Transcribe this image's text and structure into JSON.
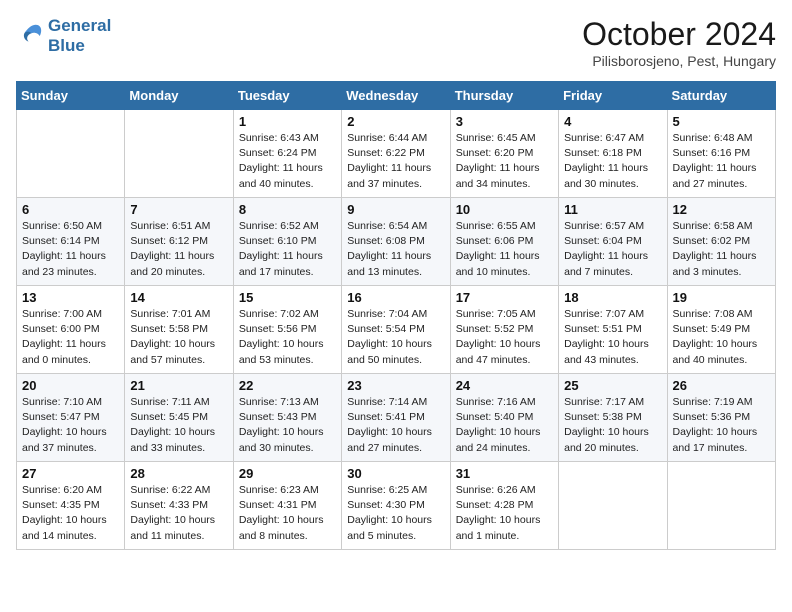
{
  "header": {
    "logo_line1": "General",
    "logo_line2": "Blue",
    "month": "October 2024",
    "location": "Pilisborosjeno, Pest, Hungary"
  },
  "weekdays": [
    "Sunday",
    "Monday",
    "Tuesday",
    "Wednesday",
    "Thursday",
    "Friday",
    "Saturday"
  ],
  "weeks": [
    [
      {
        "day": "",
        "info": ""
      },
      {
        "day": "",
        "info": ""
      },
      {
        "day": "1",
        "info": "Sunrise: 6:43 AM\nSunset: 6:24 PM\nDaylight: 11 hours and 40 minutes."
      },
      {
        "day": "2",
        "info": "Sunrise: 6:44 AM\nSunset: 6:22 PM\nDaylight: 11 hours and 37 minutes."
      },
      {
        "day": "3",
        "info": "Sunrise: 6:45 AM\nSunset: 6:20 PM\nDaylight: 11 hours and 34 minutes."
      },
      {
        "day": "4",
        "info": "Sunrise: 6:47 AM\nSunset: 6:18 PM\nDaylight: 11 hours and 30 minutes."
      },
      {
        "day": "5",
        "info": "Sunrise: 6:48 AM\nSunset: 6:16 PM\nDaylight: 11 hours and 27 minutes."
      }
    ],
    [
      {
        "day": "6",
        "info": "Sunrise: 6:50 AM\nSunset: 6:14 PM\nDaylight: 11 hours and 23 minutes."
      },
      {
        "day": "7",
        "info": "Sunrise: 6:51 AM\nSunset: 6:12 PM\nDaylight: 11 hours and 20 minutes."
      },
      {
        "day": "8",
        "info": "Sunrise: 6:52 AM\nSunset: 6:10 PM\nDaylight: 11 hours and 17 minutes."
      },
      {
        "day": "9",
        "info": "Sunrise: 6:54 AM\nSunset: 6:08 PM\nDaylight: 11 hours and 13 minutes."
      },
      {
        "day": "10",
        "info": "Sunrise: 6:55 AM\nSunset: 6:06 PM\nDaylight: 11 hours and 10 minutes."
      },
      {
        "day": "11",
        "info": "Sunrise: 6:57 AM\nSunset: 6:04 PM\nDaylight: 11 hours and 7 minutes."
      },
      {
        "day": "12",
        "info": "Sunrise: 6:58 AM\nSunset: 6:02 PM\nDaylight: 11 hours and 3 minutes."
      }
    ],
    [
      {
        "day": "13",
        "info": "Sunrise: 7:00 AM\nSunset: 6:00 PM\nDaylight: 11 hours and 0 minutes."
      },
      {
        "day": "14",
        "info": "Sunrise: 7:01 AM\nSunset: 5:58 PM\nDaylight: 10 hours and 57 minutes."
      },
      {
        "day": "15",
        "info": "Sunrise: 7:02 AM\nSunset: 5:56 PM\nDaylight: 10 hours and 53 minutes."
      },
      {
        "day": "16",
        "info": "Sunrise: 7:04 AM\nSunset: 5:54 PM\nDaylight: 10 hours and 50 minutes."
      },
      {
        "day": "17",
        "info": "Sunrise: 7:05 AM\nSunset: 5:52 PM\nDaylight: 10 hours and 47 minutes."
      },
      {
        "day": "18",
        "info": "Sunrise: 7:07 AM\nSunset: 5:51 PM\nDaylight: 10 hours and 43 minutes."
      },
      {
        "day": "19",
        "info": "Sunrise: 7:08 AM\nSunset: 5:49 PM\nDaylight: 10 hours and 40 minutes."
      }
    ],
    [
      {
        "day": "20",
        "info": "Sunrise: 7:10 AM\nSunset: 5:47 PM\nDaylight: 10 hours and 37 minutes."
      },
      {
        "day": "21",
        "info": "Sunrise: 7:11 AM\nSunset: 5:45 PM\nDaylight: 10 hours and 33 minutes."
      },
      {
        "day": "22",
        "info": "Sunrise: 7:13 AM\nSunset: 5:43 PM\nDaylight: 10 hours and 30 minutes."
      },
      {
        "day": "23",
        "info": "Sunrise: 7:14 AM\nSunset: 5:41 PM\nDaylight: 10 hours and 27 minutes."
      },
      {
        "day": "24",
        "info": "Sunrise: 7:16 AM\nSunset: 5:40 PM\nDaylight: 10 hours and 24 minutes."
      },
      {
        "day": "25",
        "info": "Sunrise: 7:17 AM\nSunset: 5:38 PM\nDaylight: 10 hours and 20 minutes."
      },
      {
        "day": "26",
        "info": "Sunrise: 7:19 AM\nSunset: 5:36 PM\nDaylight: 10 hours and 17 minutes."
      }
    ],
    [
      {
        "day": "27",
        "info": "Sunrise: 6:20 AM\nSunset: 4:35 PM\nDaylight: 10 hours and 14 minutes."
      },
      {
        "day": "28",
        "info": "Sunrise: 6:22 AM\nSunset: 4:33 PM\nDaylight: 10 hours and 11 minutes."
      },
      {
        "day": "29",
        "info": "Sunrise: 6:23 AM\nSunset: 4:31 PM\nDaylight: 10 hours and 8 minutes."
      },
      {
        "day": "30",
        "info": "Sunrise: 6:25 AM\nSunset: 4:30 PM\nDaylight: 10 hours and 5 minutes."
      },
      {
        "day": "31",
        "info": "Sunrise: 6:26 AM\nSunset: 4:28 PM\nDaylight: 10 hours and 1 minute."
      },
      {
        "day": "",
        "info": ""
      },
      {
        "day": "",
        "info": ""
      }
    ]
  ]
}
